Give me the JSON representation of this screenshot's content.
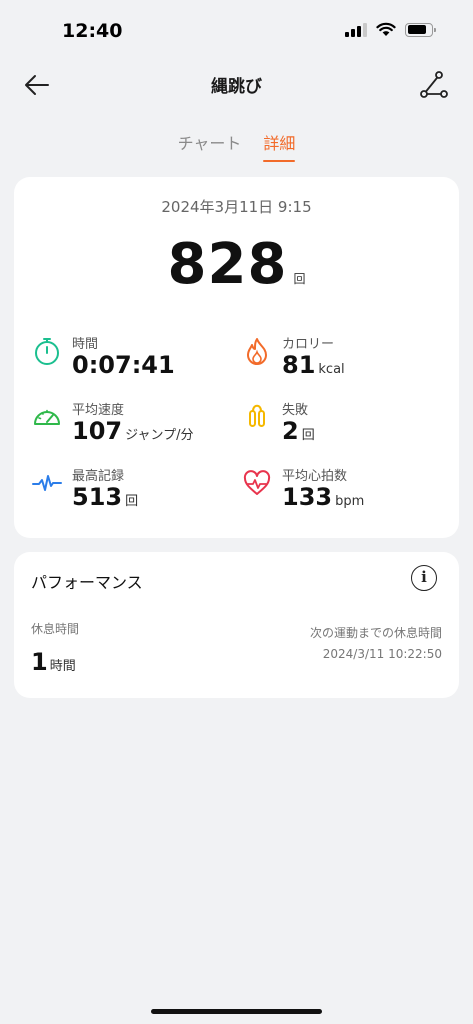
{
  "status_bar": {
    "time": "12:40"
  },
  "header": {
    "title": "縄跳び"
  },
  "tabs": [
    {
      "label": "チャート",
      "active": false
    },
    {
      "label": "詳細",
      "active": true
    }
  ],
  "summary": {
    "datetime": "2024年3月11日 9:15",
    "count": "828",
    "count_unit": "回"
  },
  "stats": [
    {
      "label": "時間",
      "value": "0:07:41",
      "unit": "",
      "icon": "stopwatch-icon",
      "color": "#1bbf8f"
    },
    {
      "label": "カロリー",
      "value": "81",
      "unit": "kcal",
      "icon": "flame-icon",
      "color": "#f26b2a"
    },
    {
      "label": "平均速度",
      "value": "107",
      "unit": "ジャンプ/分",
      "icon": "speedometer-icon",
      "color": "#2fb84a"
    },
    {
      "label": "失敗",
      "value": "2",
      "unit": "回",
      "icon": "jump-rope-icon",
      "color": "#f5b800"
    },
    {
      "label": "最高記録",
      "value": "513",
      "unit": "回",
      "icon": "pulse-wave-icon",
      "color": "#2b7de9"
    },
    {
      "label": "平均心拍数",
      "value": "133",
      "unit": "bpm",
      "icon": "heart-rate-icon",
      "color": "#e8344d"
    }
  ],
  "performance": {
    "title": "パフォーマンス",
    "rest_label": "休息時間",
    "rest_value": "1",
    "rest_unit": "時間",
    "next_label": "次の運動までの休息時間",
    "next_value": "2024/3/11 10:22:50"
  }
}
